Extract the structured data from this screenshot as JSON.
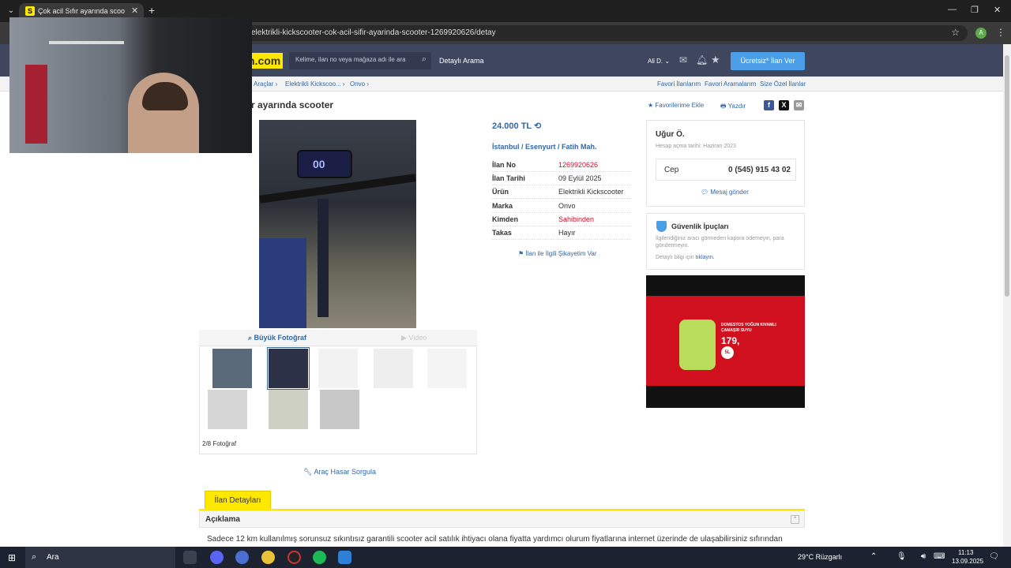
{
  "browser": {
    "tab_title": "Çok acil Sıfır ayarında scooter s",
    "favicon_letter": "S",
    "url": "elektrikli-kickscooter-cok-acil-sifir-ayarinda-scooter-1269920626/detay",
    "profile_initial": "A"
  },
  "header": {
    "logo_text": "n.com",
    "search_placeholder": "Kelime, ilan no veya mağaza adı ile ara",
    "detailed_search": "Detaylı Arama",
    "user_name": "Ali D. ⌄",
    "post_ad_label": "Ücretsiz* İlan Ver"
  },
  "breadcrumb": {
    "items": [
      "Araçlar  ›",
      "Elektrikli Kickscoo...  ›",
      "Onvo  ›"
    ],
    "right_links": [
      "Favori İlanlarım",
      "Favori Aramalarım",
      "Size Özel İlanlar"
    ]
  },
  "listing": {
    "title": "r ayarında scooter",
    "fav_add": "★ Favorilerime Ekle",
    "print": "Yazdır",
    "price": "24.000 TL",
    "location": "İstanbul  /  Esenyurt  /  Fatih Mah.",
    "display_readout": "00",
    "details": [
      {
        "key": "İlan No",
        "value": "1269920626",
        "red": true
      },
      {
        "key": "İlan Tarihi",
        "value": "09 Eylül 2025",
        "red": false
      },
      {
        "key": "Ürün",
        "value": "Elektrikli Kickscooter",
        "red": false
      },
      {
        "key": "Marka",
        "value": "Onvo",
        "red": false
      },
      {
        "key": "Kimden",
        "value": "Sahibinden",
        "red": true
      },
      {
        "key": "Takas",
        "value": "Hayır",
        "red": false
      }
    ],
    "report_link": "İlan ile İlgili Şikayetim Var"
  },
  "gallery": {
    "big_photo_tab": "Büyük Fotoğraf",
    "video_tab": "Video",
    "counter": "2/8 Fotoğraf",
    "damage_query": "Araç Hasar Sorgula"
  },
  "seller": {
    "name": "Uğur Ö.",
    "since": "Hesap açma tarihi: Haziran 2023",
    "phone_label": "Cep",
    "phone_number": "0 (545) 915 43 02",
    "message_label": "Mesaj gönder"
  },
  "safety": {
    "title": "Güvenlik İpuçları",
    "text": "İlgilendiğiniz aracı görmeden kapora ödemeyin, para göndermeyin.",
    "more_prefix": "Detaylı bilgi için ",
    "more_link": "tıklayın."
  },
  "ad": {
    "text": "DOMESTOS YOĞUN KIVAMLI ÇAMAŞIR SUYU",
    "price": "179,",
    "badge": "5L"
  },
  "details_section": {
    "tab_label": "İlan Detayları",
    "description_title": "Açıklama",
    "description_text": "Sadece 12 km kullanılmış sorunsuz sıkıntısız garantili scooter acil satılık ihtiyacı olana fiyatta yardımcı olurum fiyatlarına internet üzerinde de ulaşabilirsiniz sıfırından"
  },
  "taskbar": {
    "search_label": "Ara",
    "weather": "29°C  Rüzgarlı",
    "time": "11:13",
    "date": "13.09.2025"
  }
}
